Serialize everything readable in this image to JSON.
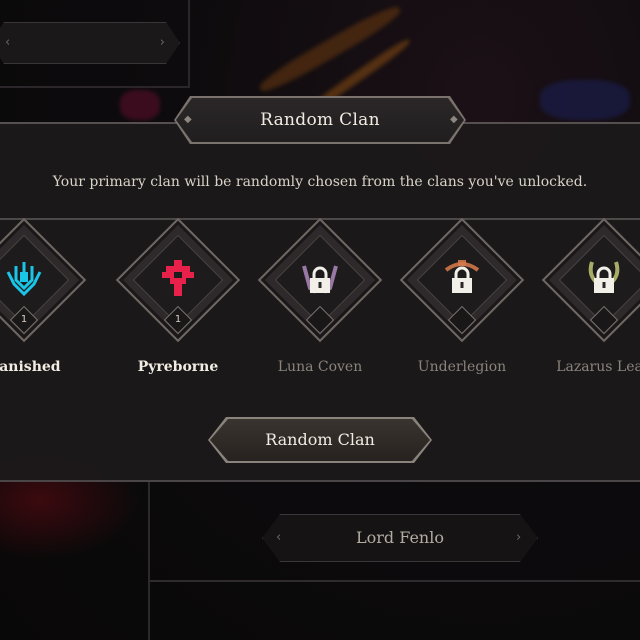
{
  "modal": {
    "title": "Random Clan",
    "description": "Your primary clan will be randomly chosen from the clans you've unlocked.",
    "button_label": "Random Clan"
  },
  "clans": [
    {
      "name": "Banished",
      "level": "1",
      "locked": false,
      "color": "#19c6e8"
    },
    {
      "name": "Pyreborne",
      "level": "1",
      "locked": false,
      "color": "#e8214b"
    },
    {
      "name": "Luna Coven",
      "level": "",
      "locked": true,
      "color": "#b691c9"
    },
    {
      "name": "Underlegion",
      "level": "",
      "locked": true,
      "color": "#d97a4a"
    },
    {
      "name": "Lazarus Leag",
      "level": "",
      "locked": true,
      "color": "#bfc774"
    }
  ],
  "background": {
    "lord_button_label": "Lord Fenlo"
  },
  "icons": {
    "chevron_left": "‹",
    "chevron_right": "›",
    "tab_dot": "◆"
  }
}
